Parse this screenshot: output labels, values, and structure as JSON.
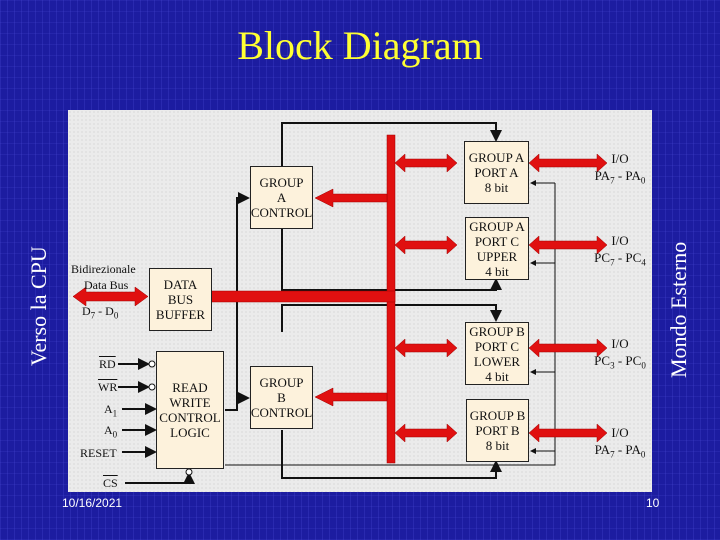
{
  "slide": {
    "title": "Block Diagram",
    "left_label": "Verso la CPU",
    "right_label": "Mondo Esterno",
    "date": "10/16/2021",
    "page_number": "10"
  },
  "blocks": {
    "group_a_control": "GROUP\nA\nCONTROL",
    "group_b_control": "GROUP\nB\nCONTROL",
    "data_bus_buffer": "DATA\nBUS\nBUFFER",
    "read_write_control": "READ\nWRITE\nCONTROL\nLOGIC",
    "port_a": "GROUP A\nPORT A\n8 bit",
    "port_c_upper": "GROUP A\nPORT C\nUPPER\n4 bit",
    "port_c_lower": "GROUP B\nPORT C\nLOWER\n4 bit",
    "port_b": "GROUP B\nPORT B\n8 bit"
  },
  "data_bus": {
    "line1": "Bidirezionale",
    "line2": "Data Bus",
    "range_main": "D",
    "range_sub_hi": "7",
    "range_sep": " - D",
    "range_sub_lo": "0"
  },
  "control_inputs": {
    "rd": "RD",
    "wr": "WR",
    "a1": "A",
    "a1_sub": "1",
    "a0": "A",
    "a0_sub": "0",
    "reset": "RESET",
    "cs": "CS"
  },
  "io_labels": [
    {
      "top": "I/O",
      "a": "PA",
      "a_sub": "7",
      "sep": " - PA",
      "b_sub": "0"
    },
    {
      "top": "I/O",
      "a": "PC",
      "a_sub": "7",
      "sep": " - PC",
      "b_sub": "4"
    },
    {
      "top": "I/O",
      "a": "PC",
      "a_sub": "3",
      "sep": " - PC",
      "b_sub": "0"
    },
    {
      "top": "I/O",
      "a": "PA",
      "a_sub": "7",
      "sep": " - PA",
      "b_sub": "0"
    }
  ],
  "colors": {
    "title": "#ffff33",
    "bus": "#e01010",
    "block_fill": "#fdf2dc",
    "background": "#1c1ca0"
  }
}
